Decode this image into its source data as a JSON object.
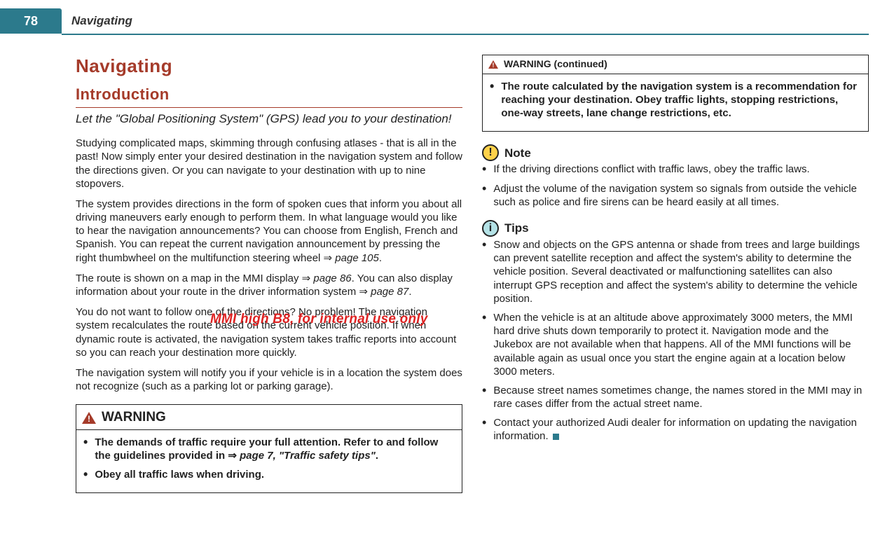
{
  "page_number": "78",
  "header_title": "Navigating",
  "watermark": "MMI high B8, for internal use only",
  "col_left": {
    "heading": "Navigating",
    "section_heading": "Introduction",
    "subtitle": "Let the \"Global Positioning System\" (GPS) lead you to your destination!",
    "p1": "Studying complicated maps, skimming through confusing atlases - that is all in the past! Now simply enter your desired destination in the navigation system and follow the directions given. Or you can navigate to your destination with up to nine stopovers.",
    "p2_a": "The system provides directions in the form of spoken cues that inform you about all driving maneuvers early enough to perform them. In what language would you like to hear the navigation announcements? You can choose from English, French and Spanish. You can repeat the current navigation announcement by pressing the right thumbwheel on the multifunction steering wheel ",
    "p2_arrow": "⇒",
    "p2_ref": "page 105",
    "p2_end": ".",
    "p3_a": "The route is shown on a map in the MMI display ",
    "p3_arrow": "⇒",
    "p3_ref1": "page 86",
    "p3_b": ". You can also display information about your route in the driver information system ",
    "p3_ref2": "page 87",
    "p3_end": ".",
    "p4": "You do not want to follow one of the directions? No problem! The navigation system recalculates the route based on the current vehicle position. If when dynamic route is activated, the navigation system takes traffic reports into account so you can reach your destination more quickly.",
    "p5": "The navigation system will notify you if your vehicle is in a location the system does not recognize (such as a parking lot or parking garage).",
    "warning": {
      "title": "WARNING",
      "items": [
        {
          "a": "The demands of traffic require your full attention. Refer to and follow the guidelines provided in ",
          "arrow": "⇒",
          "ref": "page 7, \"Traffic safety tips\"",
          "end": "."
        },
        {
          "a": "Obey all traffic laws when driving."
        }
      ]
    }
  },
  "col_right": {
    "warning_continued": {
      "title": "WARNING (continued)",
      "items": [
        {
          "a": "The route calculated by the navigation system is a recommendation for reaching your destination. Obey traffic lights, stopping restrictions, one-way streets, lane change restrictions, etc."
        }
      ]
    },
    "note": {
      "title": "Note",
      "items": [
        "If the driving directions conflict with traffic laws, obey the traffic laws.",
        "Adjust the volume of the navigation system so signals from outside the vehicle such as police and fire sirens can be heard easily at all times."
      ]
    },
    "tips": {
      "title": "Tips",
      "items": [
        "Snow and objects on the GPS antenna or shade from trees and large buildings can prevent satellite reception and affect the system's ability to determine the vehicle position. Several deactivated or malfunctioning satellites can also interrupt GPS reception and affect the system's ability to determine the vehicle position.",
        "When the vehicle is at an altitude above approximately 3000 meters, the MMI hard drive shuts down temporarily to protect it. Navigation mode and the Jukebox are not available when that happens. All of the MMI functions will be available again as usual once you start the engine again at a location below 3000 meters.",
        "Because street names sometimes change, the names stored in the MMI may in rare cases differ from the actual street name.",
        "Contact your authorized Audi dealer for information on updating the navigation information."
      ]
    }
  }
}
